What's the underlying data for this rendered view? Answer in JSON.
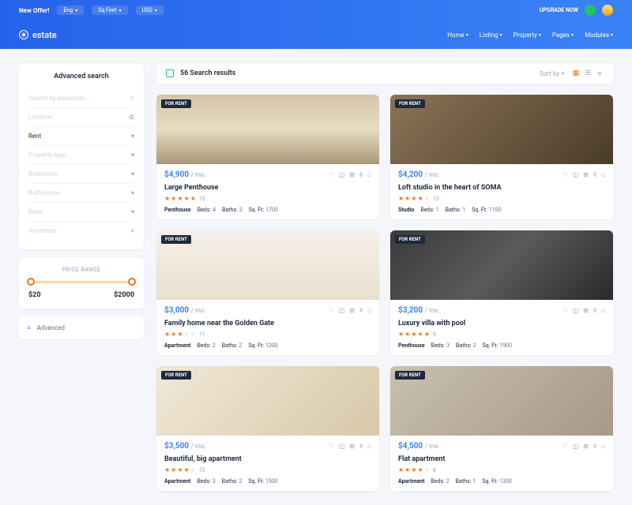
{
  "topbar": {
    "offer": "New Offer!",
    "lang": "Eng",
    "area": "Sq Feet",
    "currency": "USD",
    "upgrade": "UPGRADE NOW"
  },
  "nav": {
    "brand": "estate",
    "links": [
      "Home",
      "Listing",
      "Property",
      "Pages",
      "Modules"
    ]
  },
  "sidebar": {
    "title": "Advanced search",
    "fields": {
      "keywords": "Search by keywords...",
      "location": "Location",
      "rent": "Rent",
      "property_type": "Property type",
      "bedrooms": "Bedrooms",
      "bathrooms": "Bathrooms",
      "beds": "Beds",
      "amenities": "Amenities"
    },
    "price_label": "PRICE RANGE",
    "price_min": "$20",
    "price_max": "$2000",
    "advanced": "Advanced"
  },
  "results": {
    "count": "56 Search results",
    "sort": "Sort by"
  },
  "listings": [
    {
      "badge": "FOR RENT",
      "price": "$4,900",
      "suffix": "/ mo.",
      "title": "Large Penthouse",
      "stars": 5,
      "reviews": "15",
      "type": "Penthouse",
      "beds": "4",
      "baths": "3",
      "sqft": "1700"
    },
    {
      "badge": "FOR RENT",
      "price": "$4,200",
      "suffix": "/ mo.",
      "title": "Loft studio in the heart of SOMA",
      "stars": 4,
      "reviews": "15",
      "type": "Studio",
      "beds": "1",
      "baths": "1",
      "sqft": "1100"
    },
    {
      "badge": "FOR RENT",
      "price": "$3,000",
      "suffix": "/ mo.",
      "title": "Family home near the Golden Gate",
      "stars": 3,
      "reviews": "11",
      "type": "Apartment",
      "beds": "2",
      "baths": "2",
      "sqft": "1200"
    },
    {
      "badge": "FOR RENT",
      "price": "$3,200",
      "suffix": "/ mo.",
      "title": "Luxury villa with pool",
      "stars": 5,
      "reviews": "9",
      "type": "Penthouse",
      "beds": "3",
      "baths": "2",
      "sqft": "1900"
    },
    {
      "badge": "FOR RENT",
      "price": "$3,500",
      "suffix": "/ mo.",
      "title": "Beautiful, big apartment",
      "stars": 4,
      "reviews": "12",
      "type": "Apartment",
      "beds": "3",
      "baths": "2",
      "sqft": "1500"
    },
    {
      "badge": "FOR RENT",
      "price": "$4,500",
      "suffix": "/ mo.",
      "title": "Flat apartment",
      "stars": 4,
      "reviews": "8",
      "type": "Apartment",
      "beds": "2",
      "baths": "1",
      "sqft": "1300"
    }
  ]
}
